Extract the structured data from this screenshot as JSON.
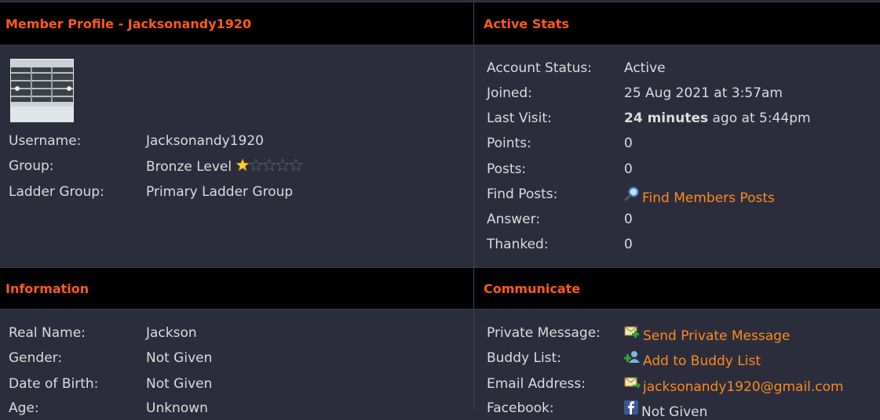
{
  "profile": {
    "header": "Member Profile - Jacksonandy1920",
    "fields": [
      {
        "label": "Username:",
        "value": "Jacksonandy1920"
      },
      {
        "label": "Group:",
        "value": "Bronze Level"
      },
      {
        "label": "Ladder Group:",
        "value": "Primary Ladder Group"
      }
    ],
    "rating": {
      "filled": 1,
      "total": 5
    }
  },
  "stats": {
    "header": "Active Stats",
    "account_status": {
      "label": "Account Status:",
      "value": "Active"
    },
    "joined": {
      "label": "Joined:",
      "value": "25 Aug 2021 at 3:57am"
    },
    "last_visit": {
      "label": "Last Visit:",
      "value_bold": "24 minutes",
      "value_rest": " ago at 5:44pm"
    },
    "points": {
      "label": "Points:",
      "value": "0"
    },
    "posts": {
      "label": "Posts:",
      "value": "0"
    },
    "find_posts": {
      "label": "Find Posts:",
      "link": "Find Members Posts"
    },
    "answer": {
      "label": "Answer:",
      "value": "0"
    },
    "thanked": {
      "label": "Thanked:",
      "value": "0"
    }
  },
  "information": {
    "header": "Information",
    "fields": [
      {
        "label": "Real Name:",
        "value": "Jackson"
      },
      {
        "label": "Gender:",
        "value": "Not Given"
      },
      {
        "label": "Date of Birth:",
        "value": "Not Given"
      },
      {
        "label": "Age:",
        "value": "Unknown"
      }
    ]
  },
  "communicate": {
    "header": "Communicate",
    "fields": [
      {
        "label": "Private Message:",
        "link": "Send Private Message"
      },
      {
        "label": "Buddy List:",
        "link": "Add to Buddy List"
      },
      {
        "label": "Email Address:",
        "link": "jacksonandy1920@gmail.com"
      },
      {
        "label": "Facebook:",
        "value": "Not Given"
      }
    ]
  },
  "colors": {
    "accent": "#ff5a1a",
    "link": "#ff8a1e",
    "panel": "#2b2d3c",
    "header_bg": "#000000"
  }
}
